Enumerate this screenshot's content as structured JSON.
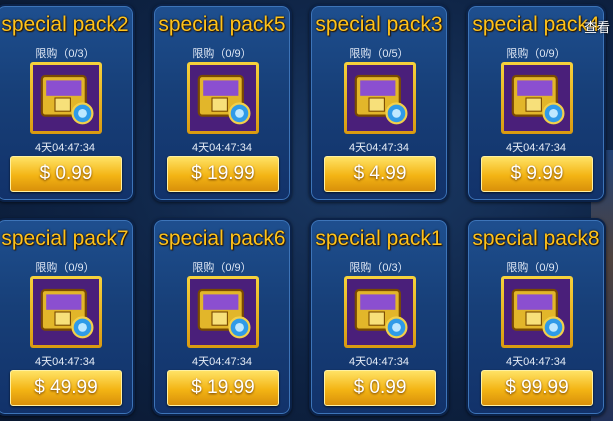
{
  "overlay": {
    "label": "查看"
  },
  "packs": [
    {
      "title": "special pack2",
      "limit": "限购（0/3）",
      "timer": "4天04:47:34",
      "price": "$ 0.99"
    },
    {
      "title": "special pack5",
      "limit": "限购（0/9）",
      "timer": "4天04:47:34",
      "price": "$ 19.99"
    },
    {
      "title": "special pack3",
      "limit": "限购（0/5）",
      "timer": "4天04:47:34",
      "price": "$ 4.99"
    },
    {
      "title": "special pack4",
      "limit": "限购（0/9）",
      "timer": "4天04:47:34",
      "price": "$ 9.99"
    },
    {
      "title": "special pack7",
      "limit": "限购（0/9）",
      "timer": "4天04:47:34",
      "price": "$ 49.99"
    },
    {
      "title": "special pack6",
      "limit": "限购（0/9）",
      "timer": "4天04:47:34",
      "price": "$ 19.99"
    },
    {
      "title": "special pack1",
      "limit": "限购（0/3）",
      "timer": "4天04:47:34",
      "price": "$ 0.99"
    },
    {
      "title": "special pack8",
      "limit": "限购（0/9）",
      "timer": "4天04:47:34",
      "price": "$ 99.99"
    }
  ],
  "icons": {
    "chest": "treasure-chest-icon"
  },
  "colors": {
    "title": "#ffc21a",
    "button": "#f3b414",
    "card": "#173f78"
  }
}
